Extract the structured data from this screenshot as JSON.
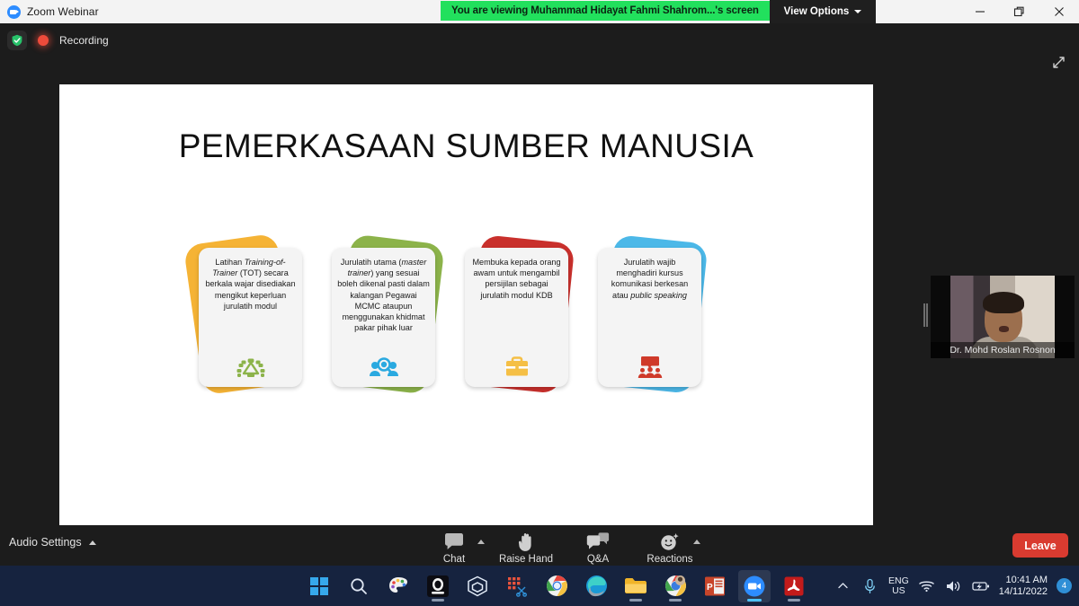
{
  "window": {
    "title": "Zoom Webinar",
    "logo_icon": "zoom-logo-icon",
    "minimize_icon": "minimize-icon",
    "restore_icon": "restore-icon",
    "close_icon": "close-icon"
  },
  "share_banner": {
    "text": "You are viewing Muhammad Hidayat Fahmi Shahrom...'s screen",
    "view_options_label": "View Options",
    "bg_color": "#22e05d"
  },
  "status": {
    "recording_label": "Recording",
    "shield_icon": "shield-check-icon",
    "record_icon": "record-dot-icon",
    "expand_icon": "expand-arrows-icon"
  },
  "slide": {
    "title": "PEMERKASAAN SUMBER MANUSIA",
    "cards": [
      {
        "text_html": "Latihan <i>Training-of-Trainer</i> (TOT) secara berkala wajar disediakan mengikut keperluan jurulatih modul",
        "blob_color": "#f5b335",
        "icon_color": "#8cb34a",
        "icon_name": "conference-table-icon"
      },
      {
        "text_html": "Jurulatih utama (<i>master trainer</i>) yang sesuai boleh dikenal pasti dalam kalangan Pegawai MCMC ataupun menggunakan khidmat pakar pihak luar",
        "blob_color": "#8cb34a",
        "icon_color": "#2aa9e0",
        "icon_name": "people-search-icon"
      },
      {
        "text_html": "Membuka kepada orang awam untuk mengambil persijilan sebagai jurulatih modul KDB",
        "blob_color": "#c9302c",
        "icon_color": "#f5bf45",
        "icon_name": "briefcase-icon"
      },
      {
        "text_html": "Jurulatih wajib menghadiri kursus komunikasi berkesan atau <i>public speaking</i>",
        "blob_color": "#4cb8e8",
        "icon_color": "#cf3a2a",
        "icon_name": "presentation-audience-icon"
      }
    ]
  },
  "video": {
    "participant_name": "Dr. Mohd Roslan Rosnon"
  },
  "toolbar": {
    "audio_settings_label": "Audio Settings",
    "items": [
      {
        "label": "Chat",
        "icon": "chat-bubble-icon",
        "has_caret": true
      },
      {
        "label": "Raise Hand",
        "icon": "raise-hand-icon",
        "has_caret": false
      },
      {
        "label": "Q&A",
        "icon": "qa-bubbles-icon",
        "has_caret": false
      },
      {
        "label": "Reactions",
        "icon": "reactions-smiley-icon",
        "has_caret": true
      }
    ],
    "leave_label": "Leave",
    "leave_color": "#d93b30"
  },
  "taskbar": {
    "apps": [
      {
        "name": "start-button",
        "icon": "windows-logo-icon",
        "running": false,
        "active": false
      },
      {
        "name": "search-button",
        "icon": "search-icon",
        "running": false,
        "active": false
      },
      {
        "name": "paint-app",
        "icon": "paint-palette-icon",
        "running": false,
        "active": false
      },
      {
        "name": "camera-app",
        "icon": "webcam-icon",
        "running": true,
        "active": false
      },
      {
        "name": "3d-viewer-app",
        "icon": "cube-3d-icon",
        "running": false,
        "active": false
      },
      {
        "name": "snipping-tool-app",
        "icon": "snipping-scissors-icon",
        "running": false,
        "active": false
      },
      {
        "name": "chrome-app",
        "icon": "chrome-icon",
        "running": false,
        "active": false
      },
      {
        "name": "edge-app",
        "icon": "edge-icon",
        "running": false,
        "active": false
      },
      {
        "name": "file-explorer-app",
        "icon": "folder-icon",
        "running": true,
        "active": false
      },
      {
        "name": "chrome-profile-app",
        "icon": "chrome-avatar-icon",
        "running": true,
        "active": false
      },
      {
        "name": "powerpoint-app",
        "icon": "powerpoint-icon",
        "running": true,
        "active": false
      },
      {
        "name": "zoom-app",
        "icon": "zoom-icon",
        "running": true,
        "active": true
      },
      {
        "name": "acrobat-app",
        "icon": "acrobat-icon",
        "running": true,
        "active": false
      }
    ],
    "tray": {
      "overflow_icon": "chevron-up-icon",
      "mic_icon": "microphone-icon",
      "language_line1": "ENG",
      "language_line2": "US",
      "wifi_icon": "wifi-icon",
      "volume_icon": "speaker-icon",
      "battery_icon": "battery-charging-icon",
      "time": "10:41 AM",
      "date": "14/11/2022",
      "notification_count": "4"
    }
  }
}
